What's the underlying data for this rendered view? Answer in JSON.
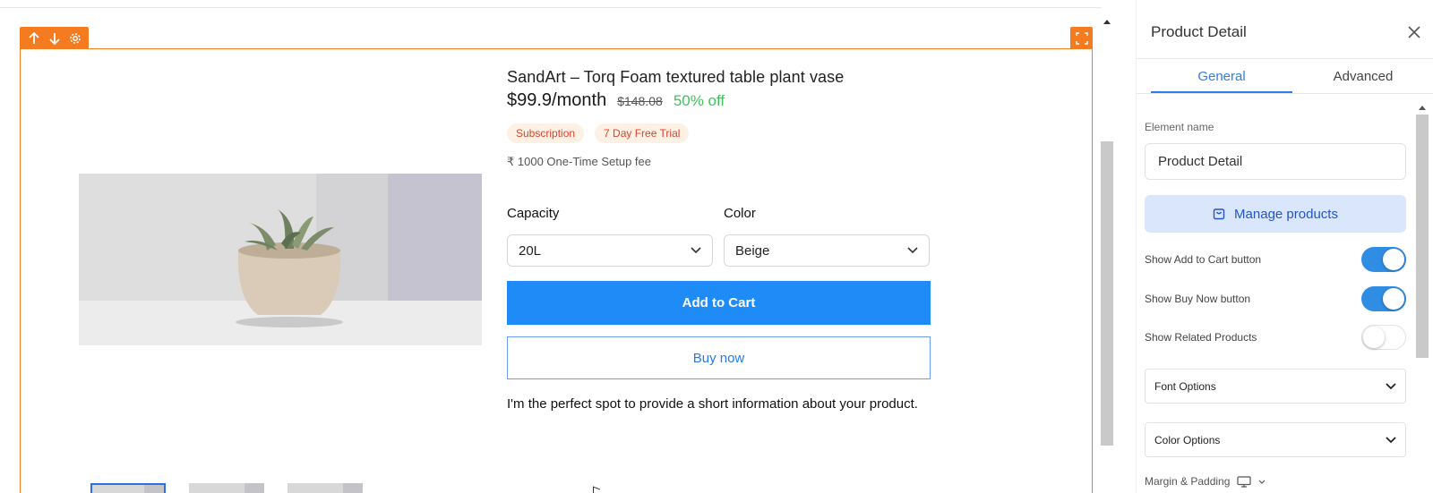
{
  "editor": {
    "toolbar": {
      "move_up_icon": "arrow-up-icon",
      "move_down_icon": "arrow-down-icon",
      "settings_icon": "gear-icon",
      "expand_icon": "expand-icon"
    },
    "accent_color": "#f47b20"
  },
  "product": {
    "title": "SandArt – Torq Foam textured table plant vase",
    "price": "$99.9/month",
    "old_price": "$148.08",
    "discount": "50% off",
    "badges": [
      "Subscription",
      "7 Day Free Trial"
    ],
    "setup_fee": "₹ 1000 One-Time Setup fee",
    "capacity": {
      "label": "Capacity",
      "value": "20L"
    },
    "color": {
      "label": "Color",
      "value": "Beige"
    },
    "add_to_cart": "Add to Cart",
    "buy_now": "Buy now",
    "short_info": "I'm the perfect spot to provide a short information about your product.",
    "primary_color": "#1e8bf7",
    "discount_color": "#3fc35c"
  },
  "panel": {
    "title": "Product Detail",
    "tabs": [
      {
        "label": "General",
        "active": true
      },
      {
        "label": "Advanced",
        "active": false
      }
    ],
    "element_name_label": "Element name",
    "element_name_value": "Product Detail",
    "manage_products": "Manage products",
    "toggles": [
      {
        "label": "Show Add to Cart button",
        "on": true
      },
      {
        "label": "Show Buy Now button",
        "on": true
      },
      {
        "label": "Show Related Products",
        "on": false
      }
    ],
    "accordions": [
      "Font Options",
      "Color Options"
    ],
    "margin_padding": "Margin & Padding",
    "accent_color": "#2f7de6"
  }
}
